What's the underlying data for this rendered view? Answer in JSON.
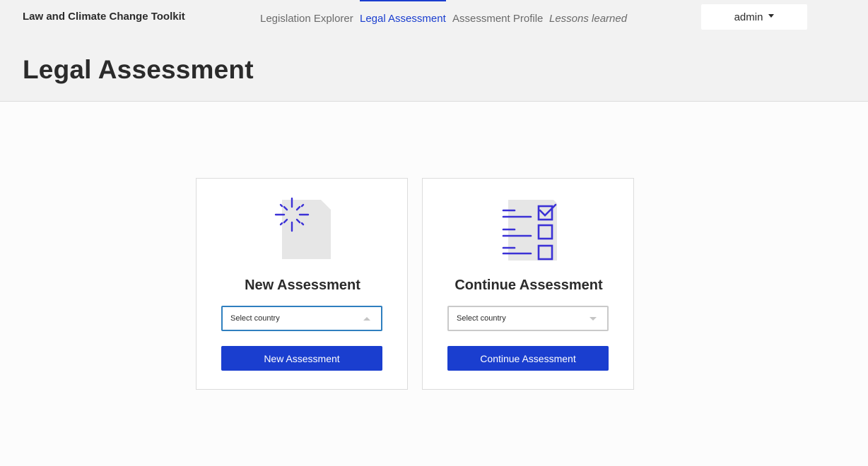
{
  "app": {
    "brand": "Law and Climate Change Toolkit"
  },
  "nav": {
    "items": [
      {
        "label": "Legislation Explorer",
        "active": false
      },
      {
        "label": "Legal Assessment",
        "active": true
      },
      {
        "label": "Assessment Profile",
        "active": false
      },
      {
        "label": "Lessons learned",
        "active": false
      }
    ]
  },
  "user": {
    "name": "admin"
  },
  "page": {
    "title": "Legal Assessment"
  },
  "cards": {
    "new": {
      "icon": "new-document-icon",
      "title": "New Assessment",
      "select_placeholder": "Select country",
      "button_label": "New Assessment"
    },
    "continue": {
      "icon": "checklist-icon",
      "title": "Continue Assessment",
      "select_placeholder": "Select country",
      "button_label": "Continue Assessment"
    }
  },
  "colors": {
    "accent": "#1a3ecf",
    "header_bg": "#f2f2f2",
    "page_bg": "#fcfcfc",
    "focus_border": "#2f7fbf"
  }
}
